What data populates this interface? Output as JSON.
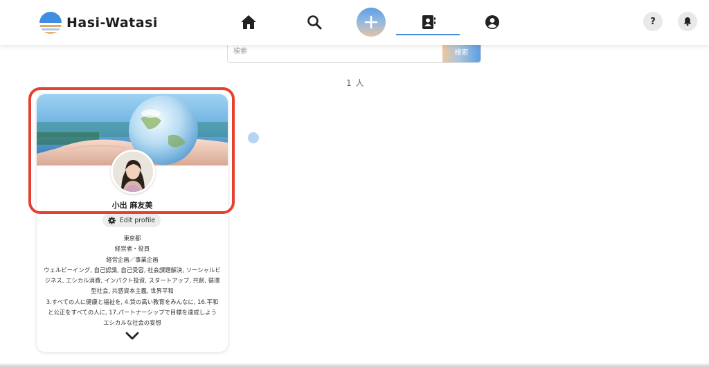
{
  "header": {
    "logo_text": "Hasi-Watasi",
    "nav": [
      {
        "name": "home",
        "icon": "home-icon"
      },
      {
        "name": "search",
        "icon": "search-icon"
      },
      {
        "name": "add",
        "icon": "plus-icon"
      },
      {
        "name": "contacts",
        "icon": "contacts-icon",
        "active": true
      },
      {
        "name": "profile",
        "icon": "user-circle-icon"
      }
    ],
    "help_label": "?",
    "bell_icon": "bell-icon"
  },
  "search": {
    "placeholder": "検索",
    "button_label": "検索"
  },
  "result_count": "1 人",
  "card": {
    "name": "小出 麻友美",
    "edit_label": "Edit profile",
    "location": "東京都",
    "role": "経営者・役員",
    "job": "経営企画／事業企画",
    "interests_lines": [
      "ウェルビーイング, 自己認識, 自己受容, 社会課題解決, ソーシャルビ",
      "ジネス, エシカル消費, インパクト投資, スタートアップ, 共創, 循環",
      "型社会, 共感資本主義, 世界平和"
    ],
    "sdgs_lines": [
      "3.すべての人に健康と福祉を, 4.質の高い教育をみんなに, 16.平和",
      "と公正をすべての人に, 17.パートナーシップで目標を達成しよう",
      "エシカルな社会の妄想"
    ]
  },
  "colors": {
    "accent_blue": "#4b8fd9",
    "highlight_red": "#e6402f"
  }
}
